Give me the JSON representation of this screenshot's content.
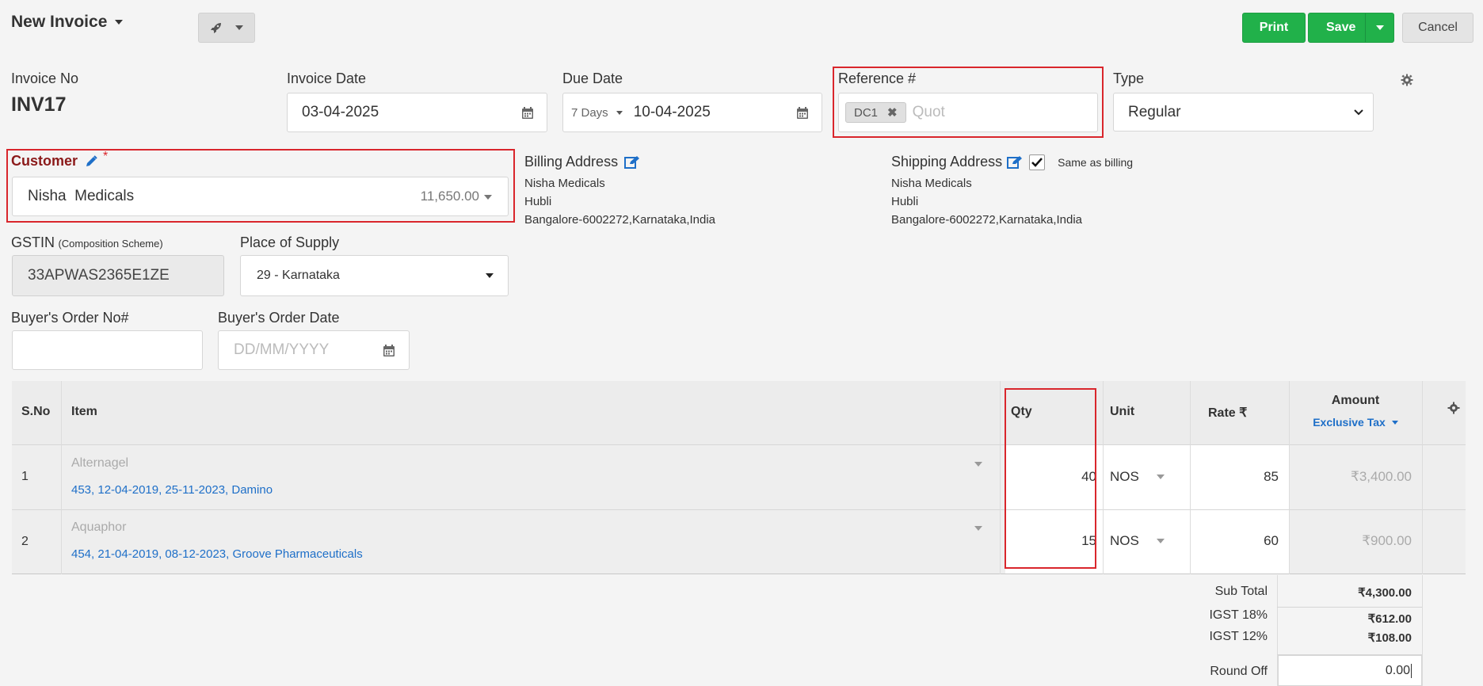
{
  "header": {
    "title": "New Invoice",
    "print_label": "Print",
    "save_label": "Save",
    "cancel_label": "Cancel"
  },
  "invoice": {
    "no_label": "Invoice No",
    "no_value": "INV17",
    "date_label": "Invoice Date",
    "date_value": "03-04-2025",
    "due_label": "Due Date",
    "due_terms": "7 Days",
    "due_value": "10-04-2025",
    "ref_label": "Reference #",
    "ref_tag": "DC1",
    "ref_placeholder": "Quot",
    "type_label": "Type",
    "type_value": "Regular"
  },
  "customer": {
    "label": "Customer",
    "required_mark": "*",
    "name": "Nisha  Medicals",
    "balance": "11,650.00"
  },
  "billing": {
    "label": "Billing Address",
    "line1": "Nisha Medicals",
    "line2": "Hubli",
    "line3": "Bangalore-6002272,Karnataka,India"
  },
  "shipping": {
    "label": "Shipping Address",
    "same_label": "Same as billing",
    "line1": "Nisha Medicals",
    "line2": "Hubli",
    "line3": "Bangalore-6002272,Karnataka,India"
  },
  "gstin": {
    "label": "GSTIN",
    "scheme": "(Composition Scheme)",
    "value": "33APWAS2365E1ZE"
  },
  "supply": {
    "label": "Place of Supply",
    "value": "29 - Karnataka"
  },
  "buyer": {
    "order_label": "Buyer's Order No#",
    "order_value": "",
    "date_label": "Buyer's Order Date",
    "date_placeholder": "DD/MM/YYYY"
  },
  "table": {
    "headers": {
      "sno": "S.No",
      "item": "Item",
      "qty": "Qty",
      "unit": "Unit",
      "rate": "Rate ₹",
      "amount": "Amount",
      "tax_mode": "Exclusive Tax"
    },
    "rows": [
      {
        "sno": "1",
        "item": "Alternagel",
        "batch": "453, 12-04-2019, 25-11-2023, Damino",
        "qty": "40",
        "unit": "NOS",
        "rate": "85",
        "amount": "₹3,400.00"
      },
      {
        "sno": "2",
        "item": "Aquaphor",
        "batch": "454, 21-04-2019, 08-12-2023, Groove Pharmaceuticals",
        "qty": "15",
        "unit": "NOS",
        "rate": "60",
        "amount": "₹900.00"
      }
    ]
  },
  "totals": {
    "subtotal_label": "Sub Total",
    "subtotal_value": "₹4,300.00",
    "igst18_label": "IGST 18%",
    "igst18_value": "₹612.00",
    "igst12_label": "IGST 12%",
    "igst12_value": "₹108.00",
    "roundoff_label": "Round Off",
    "roundoff_value": "0.00"
  },
  "colors": {
    "accent_green": "#21b14a",
    "link_blue": "#1e6fc8",
    "highlight_red": "#d9262c",
    "customer_label": "#8b1a1a"
  }
}
